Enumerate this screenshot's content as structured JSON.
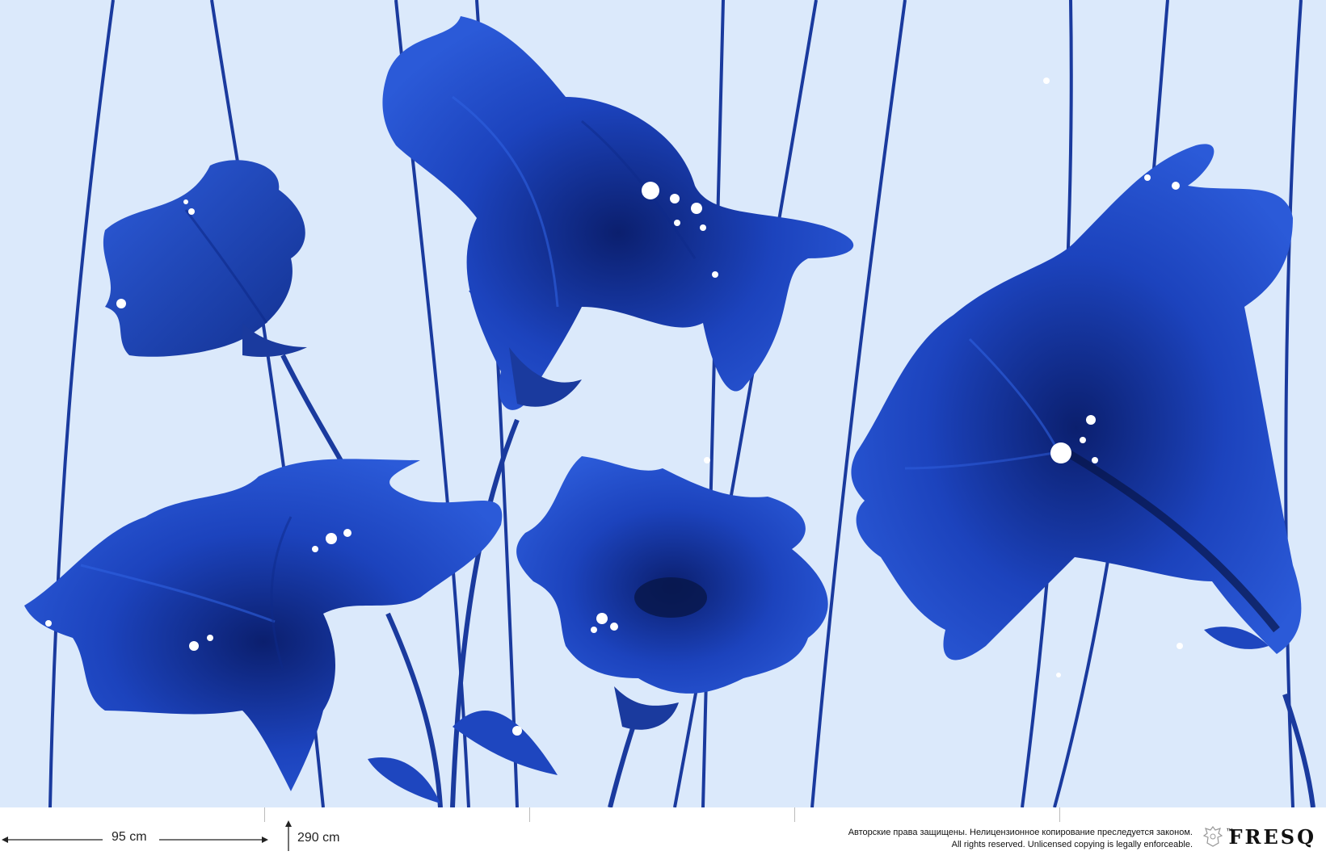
{
  "artwork": {
    "colors": {
      "background": "#dbe9fb",
      "petal": "#1f48c4",
      "petal_dark": "#0e2a8a",
      "stem": "#1a3a9e",
      "dew": "#ffffff"
    }
  },
  "footer": {
    "panel_width_label": "95 cm",
    "height_label": "290 cm",
    "copyright_ru": "Авторские права защищены. Нелицензионное копирование преследуется законом.",
    "copyright_en": "All rights reserved. Unlicensed copying is legally enforceable.",
    "trademark": "™",
    "brand": "FRESQ"
  }
}
